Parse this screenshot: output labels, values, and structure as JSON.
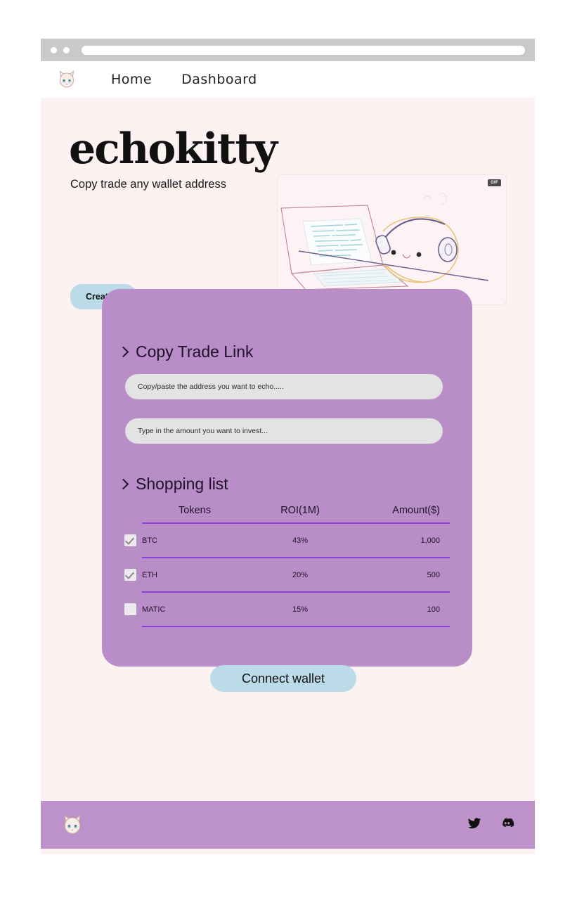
{
  "browser": {
    "url_value": "",
    "dots": [
      "window-dot",
      "window-dot"
    ]
  },
  "nav": {
    "logo_name": "echokitty-cat-logo",
    "links": [
      {
        "label": "Home"
      },
      {
        "label": "Dashboard"
      }
    ]
  },
  "hero": {
    "title": "echokitty",
    "tagline": "Copy trade any wallet address",
    "cta_label": "Create p",
    "illustration": {
      "badge": "GIF",
      "alt_name": "cat-with-headphones-at-laptop-illustration"
    }
  },
  "trade_card": {
    "copy_trade": {
      "heading": "Copy Trade Link",
      "address_placeholder": "Copy/paste the address you want to echo.....",
      "address_value": "",
      "amount_placeholder": "Type in the amount you want to invest...",
      "amount_value": ""
    },
    "shopping_list": {
      "heading": "Shopping list",
      "columns": [
        "Tokens",
        "ROI(1M)",
        "Amount($)"
      ],
      "rows": [
        {
          "checked": true,
          "token": "BTC",
          "roi": "43%",
          "amount": "1,000"
        },
        {
          "checked": true,
          "token": "ETH",
          "roi": "20%",
          "amount": "500"
        },
        {
          "checked": false,
          "token": "MATIC",
          "roi": "15%",
          "amount": "100"
        }
      ]
    },
    "connect_label": "Connect wallet"
  },
  "footer": {
    "logo_name": "echokitty-cat-logo",
    "socials": [
      {
        "name": "twitter-icon"
      },
      {
        "name": "discord-icon"
      }
    ]
  },
  "colors": {
    "card_purple": "#b98dc8",
    "footer_purple": "#bd92cb",
    "page_bg": "#fcf2f2",
    "accent_blue": "#bcdbe8",
    "table_rule": "#8c3fd6"
  }
}
